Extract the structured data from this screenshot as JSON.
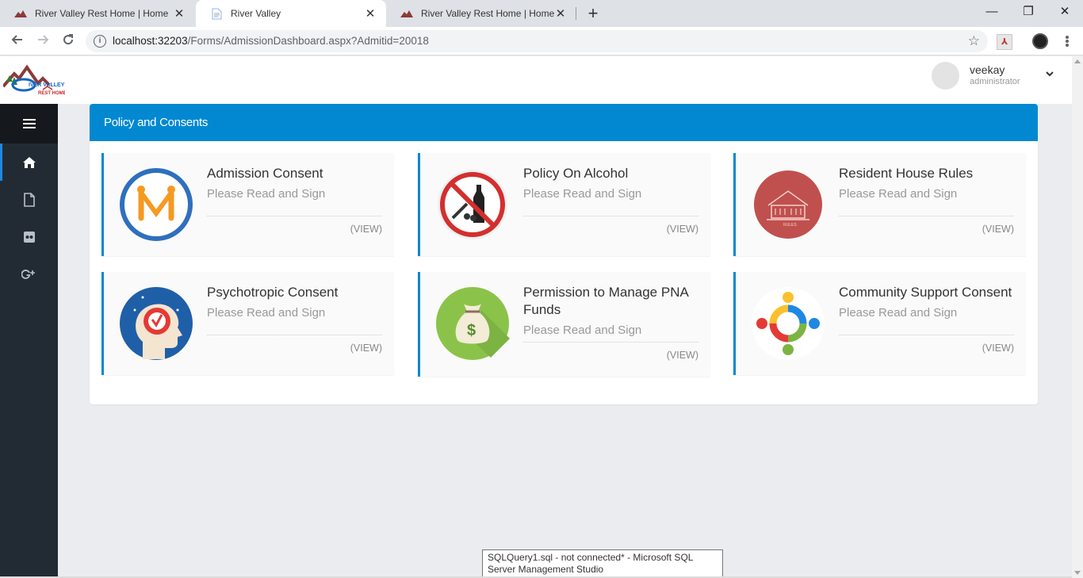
{
  "browser": {
    "tabs": [
      {
        "title": "River Valley Rest Home | Home",
        "active": false
      },
      {
        "title": "River Valley",
        "active": true
      },
      {
        "title": "River Valley Rest Home | Home",
        "active": false
      }
    ],
    "tab_close": "✕",
    "new_tab": "+",
    "window_controls": {
      "minimize": "—",
      "maximize": "❐",
      "close": "✕"
    },
    "address": {
      "host": "localhost:32203",
      "path": "/Forms/AdmissionDashboard.aspx?Admitid=20018"
    },
    "extension_pdf": "⅄"
  },
  "header": {
    "user_name": "veekay",
    "user_role": "administrator"
  },
  "sidebar": {
    "items": [
      {
        "icon": "home-icon",
        "active": true
      },
      {
        "icon": "file-icon",
        "active": false
      },
      {
        "icon": "flickr-icon",
        "active": false
      },
      {
        "icon": "google-plus-icon",
        "active": false
      }
    ]
  },
  "panel": {
    "title": "Policy and Consents",
    "cards": [
      {
        "title": "Admission Consent",
        "subtitle": "Please Read and Sign",
        "action": "(VIEW)"
      },
      {
        "title": "Policy On Alcohol",
        "subtitle": "Please Read and Sign",
        "action": "(VIEW)"
      },
      {
        "title": "Resident House Rules",
        "subtitle": "Please Read and Sign",
        "action": "(VIEW)"
      },
      {
        "title": "Psychotropic Consent",
        "subtitle": "Please Read and Sign",
        "action": "(VIEW)"
      },
      {
        "title": "Permission to Manage PNA Funds",
        "subtitle": "Please Read and Sign",
        "action": "(VIEW)"
      },
      {
        "title": "Community Support Consent",
        "subtitle": "Please Read and Sign",
        "action": "(VIEW)"
      }
    ]
  },
  "colors": {
    "accent": "#0288d1",
    "sidebar": "#222b33",
    "background": "#ebecef"
  },
  "taskbar_tooltip": "SQLQuery1.sql - not connected* - Microsoft SQL Server Management Studio"
}
